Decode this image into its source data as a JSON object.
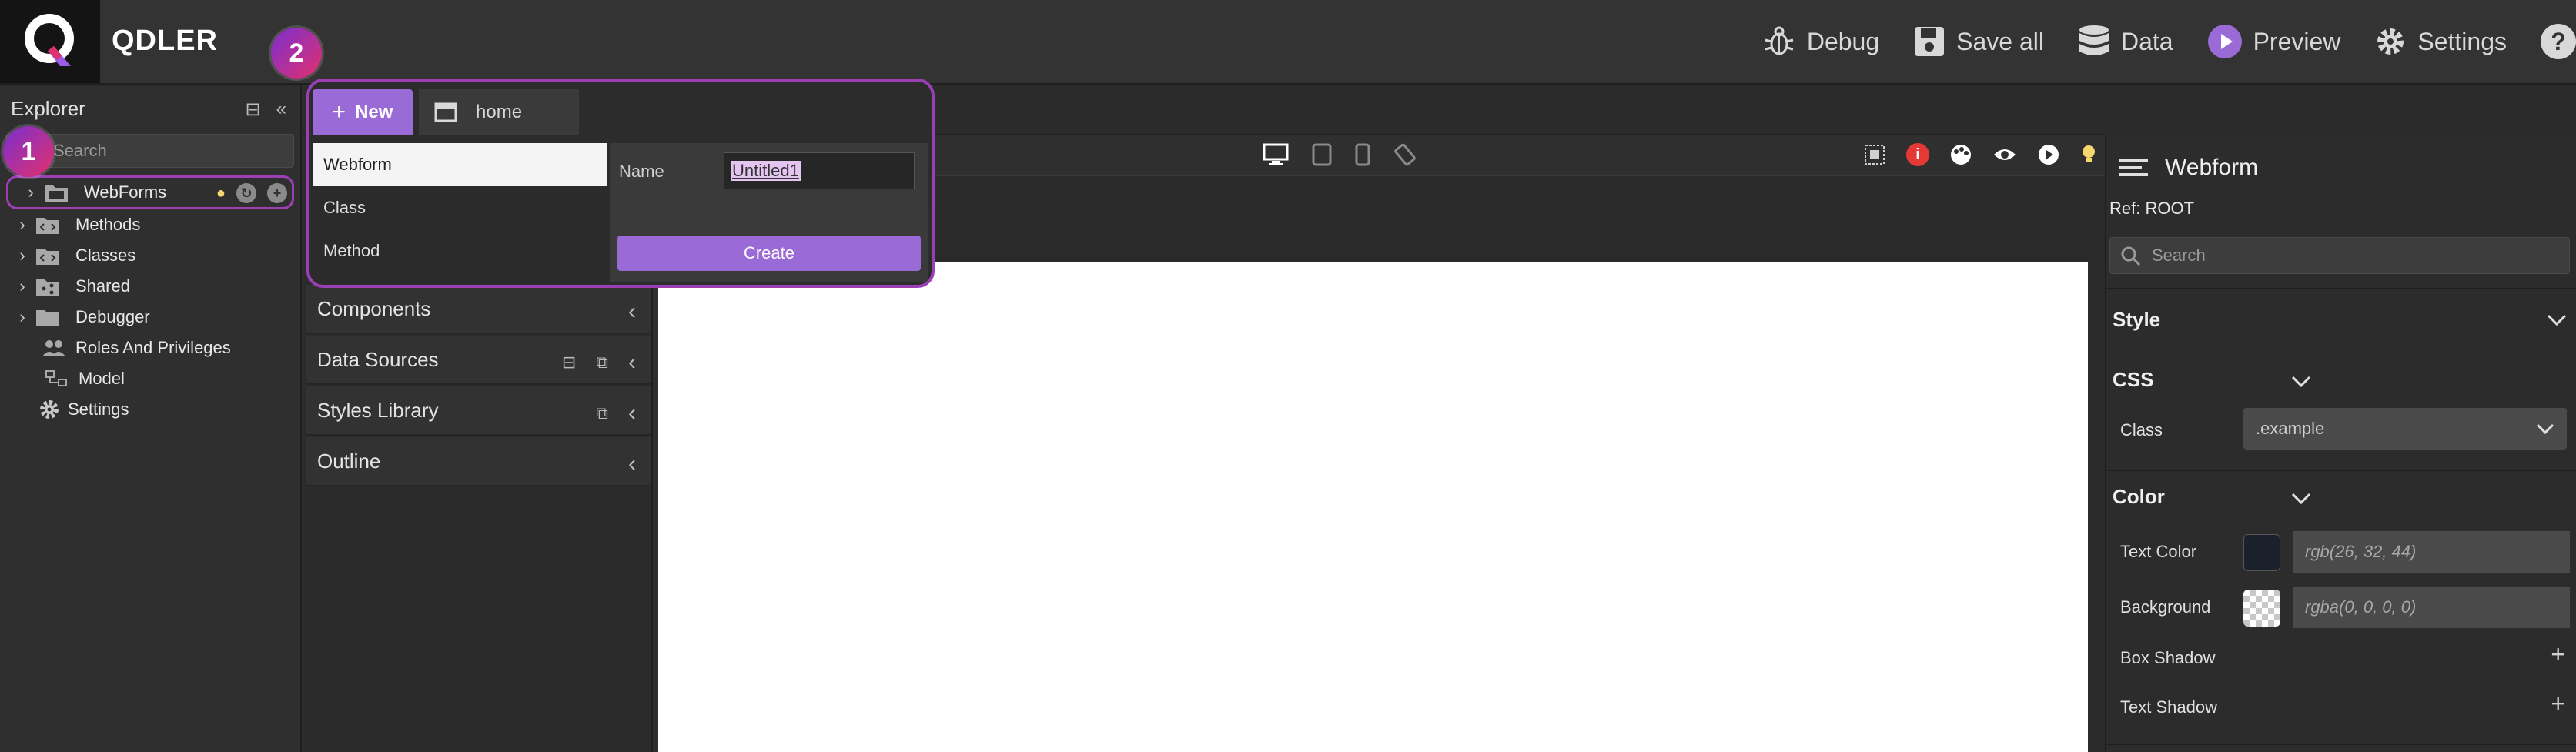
{
  "app": {
    "name": "QDLER"
  },
  "topbar": {
    "debug_label": "Debug",
    "save_label": "Save all",
    "data_label": "Data",
    "preview_label": "Preview",
    "settings_label": "Settings",
    "help_label": "?"
  },
  "badges": {
    "one": "1",
    "two": "2"
  },
  "explorer": {
    "title": "Explorer",
    "search_placeholder": "Search",
    "items": [
      {
        "label": "WebForms",
        "icon": "folder-window-icon"
      },
      {
        "label": "Methods",
        "icon": "code-folder-icon"
      },
      {
        "label": "Classes",
        "icon": "code-folder-icon"
      },
      {
        "label": "Shared",
        "icon": "share-folder-icon"
      },
      {
        "label": "Debugger",
        "icon": "folder-icon"
      },
      {
        "label": "Roles And Privileges",
        "icon": "users-icon"
      },
      {
        "label": "Model",
        "icon": "model-icon"
      },
      {
        "label": "Settings",
        "icon": "gear-icon"
      }
    ]
  },
  "new_popup": {
    "new_label": "New",
    "home_tab": "home",
    "types": [
      "Webform",
      "Class",
      "Method"
    ],
    "name_label": "Name",
    "name_value": "Untitled1",
    "create_label": "Create"
  },
  "panels": {
    "components": "Components",
    "data_sources": "Data Sources",
    "styles_library": "Styles Library",
    "outline": "Outline"
  },
  "props": {
    "title": "Webform",
    "ref": "Ref: ROOT",
    "search_placeholder": "Search",
    "style_label": "Style",
    "css_label": "CSS",
    "class_label": "Class",
    "class_value": ".example",
    "color_label": "Color",
    "text_color_label": "Text Color",
    "text_color_value": "rgb(26, 32, 44)",
    "background_label": "Background",
    "background_value": "rgba(0, 0, 0, 0)",
    "box_shadow_label": "Box Shadow",
    "text_shadow_label": "Text Shadow"
  },
  "colors": {
    "accent": "#9a6ad6",
    "highlight_border": "#9b3fb5",
    "text_color_swatch": "#1a202c"
  }
}
